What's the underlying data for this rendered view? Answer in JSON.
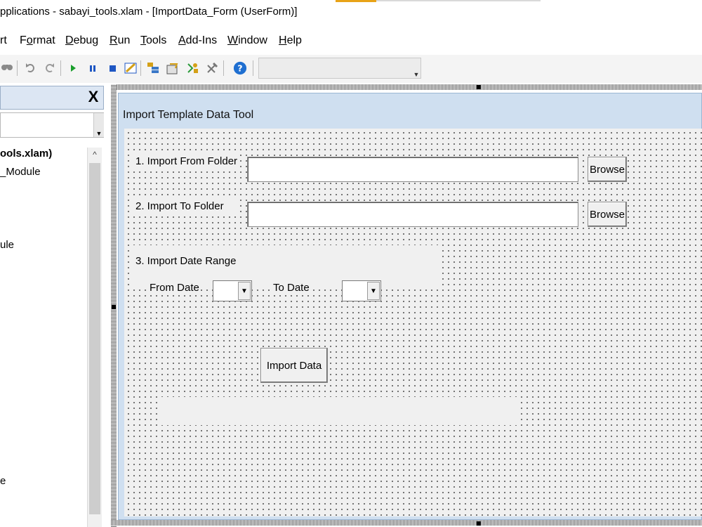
{
  "window": {
    "title": "pplications - sabayi_tools.xlam - [ImportData_Form (UserForm)]"
  },
  "menu": {
    "items": [
      {
        "pre": "rt",
        "ul": "",
        "post": ""
      },
      {
        "pre": "F",
        "ul": "o",
        "post": "rmat"
      },
      {
        "pre": "",
        "ul": "D",
        "post": "ebug"
      },
      {
        "pre": "",
        "ul": "R",
        "post": "un"
      },
      {
        "pre": "",
        "ul": "T",
        "post": "ools"
      },
      {
        "pre": "",
        "ul": "A",
        "post": "dd-Ins"
      },
      {
        "pre": "",
        "ul": "W",
        "post": "indow"
      },
      {
        "pre": "",
        "ul": "H",
        "post": "elp"
      }
    ]
  },
  "toolbar": {
    "icons": [
      "find-icon",
      "undo-icon",
      "redo-icon",
      "run-icon",
      "pause-icon",
      "stop-icon",
      "design-mode-icon",
      "project-explorer-icon",
      "properties-icon",
      "object-browser-icon",
      "toolbox-icon",
      "help-icon"
    ],
    "colors": {
      "run": "#1a9e2c",
      "pause": "#1f57c3",
      "stop": "#1f57c3",
      "help": "#1f6fd1"
    }
  },
  "explorer": {
    "close_glyph": "X",
    "tree": {
      "project": "ools.xlam)",
      "module": "_Module",
      "item3": "ule",
      "item4": "e"
    }
  },
  "form": {
    "caption": "Import Template Data Tool",
    "import_from_label": "1. Import From Folder",
    "import_to_label": "2. Import To Folder",
    "browse_label": "Browse",
    "date_range_label": "3. Import Date Range",
    "from_date_label": "From Date",
    "to_date_label": "To Date",
    "import_button_label": "Import Data"
  },
  "colors": {
    "form_title_bar": "#cfdff0",
    "form_background": "#f0f0f0",
    "explorer_header": "#dce6f3"
  }
}
